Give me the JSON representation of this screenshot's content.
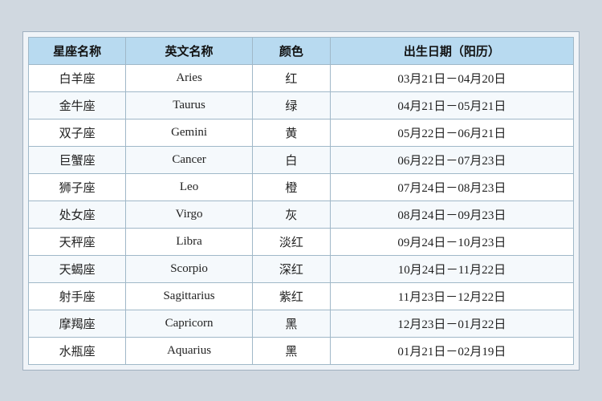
{
  "table": {
    "headers": {
      "zh_name": "星座名称",
      "en_name": "英文名称",
      "color": "颜色",
      "date_range": "出生日期（阳历）"
    },
    "rows": [
      {
        "zh": "白羊座",
        "en": "Aries",
        "color": "红",
        "date": "03月21日－04月20日"
      },
      {
        "zh": "金牛座",
        "en": "Taurus",
        "color": "绿",
        "date": "04月21日－05月21日"
      },
      {
        "zh": "双子座",
        "en": "Gemini",
        "color": "黄",
        "date": "05月22日－06月21日"
      },
      {
        "zh": "巨蟹座",
        "en": "Cancer",
        "color": "白",
        "date": "06月22日－07月23日"
      },
      {
        "zh": "狮子座",
        "en": "Leo",
        "color": "橙",
        "date": "07月24日－08月23日"
      },
      {
        "zh": "处女座",
        "en": "Virgo",
        "color": "灰",
        "date": "08月24日－09月23日"
      },
      {
        "zh": "天秤座",
        "en": "Libra",
        "color": "淡红",
        "date": "09月24日－10月23日"
      },
      {
        "zh": "天蝎座",
        "en": "Scorpio",
        "color": "深红",
        "date": "10月24日－11月22日"
      },
      {
        "zh": "射手座",
        "en": "Sagittarius",
        "color": "紫红",
        "date": "11月23日－12月22日"
      },
      {
        "zh": "摩羯座",
        "en": "Capricorn",
        "color": "黑",
        "date": "12月23日－01月22日"
      },
      {
        "zh": "水瓶座",
        "en": "Aquarius",
        "color": "黑",
        "date": "01月21日－02月19日"
      }
    ]
  }
}
